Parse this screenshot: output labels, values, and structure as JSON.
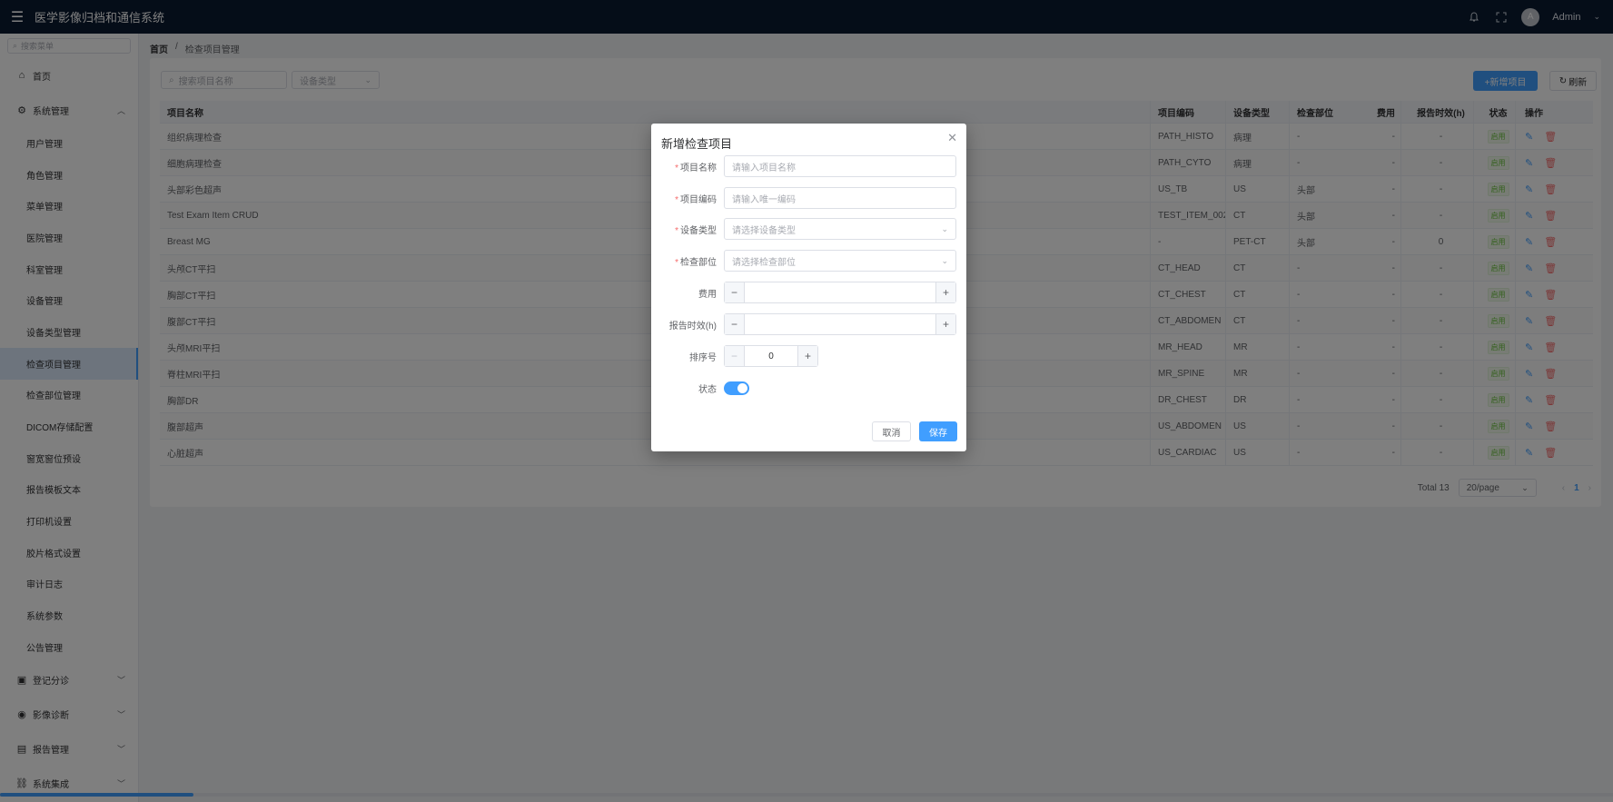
{
  "header": {
    "app_title": "医学影像归档和通信系统",
    "user_name": "Admin",
    "avatar_letter": "A"
  },
  "sidebar": {
    "search_placeholder": "搜索菜单",
    "home": "首页",
    "system_group": "系统管理",
    "sub_items": [
      "用户管理",
      "角色管理",
      "菜单管理",
      "医院管理",
      "科室管理",
      "设备管理",
      "设备类型管理",
      "检查项目管理",
      "检查部位管理",
      "DICOM存储配置",
      "窗宽窗位预设",
      "报告模板文本",
      "打印机设置",
      "胶片格式设置",
      "审计日志",
      "系统参数",
      "公告管理"
    ],
    "active_index": 7,
    "groups": [
      "登记分诊",
      "影像诊断",
      "报告管理",
      "系统集成"
    ]
  },
  "breadcrumb": {
    "home": "首页",
    "separator": "/",
    "current": "检查项目管理"
  },
  "toolbar": {
    "search_placeholder": "搜索项目名称",
    "modality_placeholder": "设备类型",
    "add_label": "+新增项目",
    "refresh_label": "刷新"
  },
  "table": {
    "headers": {
      "name": "项目名称",
      "code": "项目编码",
      "modality": "设备类型",
      "part": "检查部位",
      "fee": "费用",
      "tat": "报告时效(h)",
      "status": "状态",
      "ops": "操作"
    },
    "rows": [
      {
        "name": "组织病理检查",
        "code": "PATH_HISTO",
        "modality": "病理",
        "part": "-",
        "fee": "-",
        "tat": "-",
        "status": "启用"
      },
      {
        "name": "细胞病理检查",
        "code": "PATH_CYTO",
        "modality": "病理",
        "part": "-",
        "fee": "-",
        "tat": "-",
        "status": "启用"
      },
      {
        "name": "头部彩色超声",
        "code": "US_TB",
        "modality": "US",
        "part": "头部",
        "fee": "-",
        "tat": "-",
        "status": "启用"
      },
      {
        "name": "Test Exam Item CRUD",
        "code": "TEST_ITEM_002",
        "modality": "CT",
        "part": "头部",
        "fee": "-",
        "tat": "-",
        "status": "启用"
      },
      {
        "name": "Breast MG",
        "code": "-",
        "modality": "PET-CT",
        "part": "头部",
        "fee": "-",
        "tat": "0",
        "status": "启用"
      },
      {
        "name": "头颅CT平扫",
        "code": "CT_HEAD",
        "modality": "CT",
        "part": "-",
        "fee": "-",
        "tat": "-",
        "status": "启用"
      },
      {
        "name": "胸部CT平扫",
        "code": "CT_CHEST",
        "modality": "CT",
        "part": "-",
        "fee": "-",
        "tat": "-",
        "status": "启用"
      },
      {
        "name": "腹部CT平扫",
        "code": "CT_ABDOMEN",
        "modality": "CT",
        "part": "-",
        "fee": "-",
        "tat": "-",
        "status": "启用"
      },
      {
        "name": "头颅MRI平扫",
        "code": "MR_HEAD",
        "modality": "MR",
        "part": "-",
        "fee": "-",
        "tat": "-",
        "status": "启用"
      },
      {
        "name": "脊柱MRI平扫",
        "code": "MR_SPINE",
        "modality": "MR",
        "part": "-",
        "fee": "-",
        "tat": "-",
        "status": "启用"
      },
      {
        "name": "胸部DR",
        "code": "DR_CHEST",
        "modality": "DR",
        "part": "-",
        "fee": "-",
        "tat": "-",
        "status": "启用"
      },
      {
        "name": "腹部超声",
        "code": "US_ABDOMEN",
        "modality": "US",
        "part": "-",
        "fee": "-",
        "tat": "-",
        "status": "启用"
      },
      {
        "name": "心脏超声",
        "code": "US_CARDIAC",
        "modality": "US",
        "part": "-",
        "fee": "-",
        "tat": "-",
        "status": "启用"
      }
    ]
  },
  "pagination": {
    "total": "Total 13",
    "page_size": "20/page",
    "current_page": "1"
  },
  "dialog": {
    "title": "新增检查项目",
    "fields": {
      "name_label": "项目名称",
      "name_placeholder": "请输入项目名称",
      "code_label": "项目编码",
      "code_placeholder": "请输入唯一编码",
      "modality_label": "设备类型",
      "modality_placeholder": "请选择设备类型",
      "part_label": "检查部位",
      "part_placeholder": "请选择检查部位",
      "fee_label": "费用",
      "tat_label": "报告时效(h)",
      "sort_label": "排序号",
      "sort_value": "0",
      "status_label": "状态"
    },
    "cancel_label": "取消",
    "save_label": "保存"
  },
  "colors": {
    "primary": "#409eff",
    "header_bg": "#0b1a30",
    "danger": "#f56c6c",
    "success": "#67c23a"
  },
  "scroll": {
    "horizontal_fraction": 0.12
  }
}
